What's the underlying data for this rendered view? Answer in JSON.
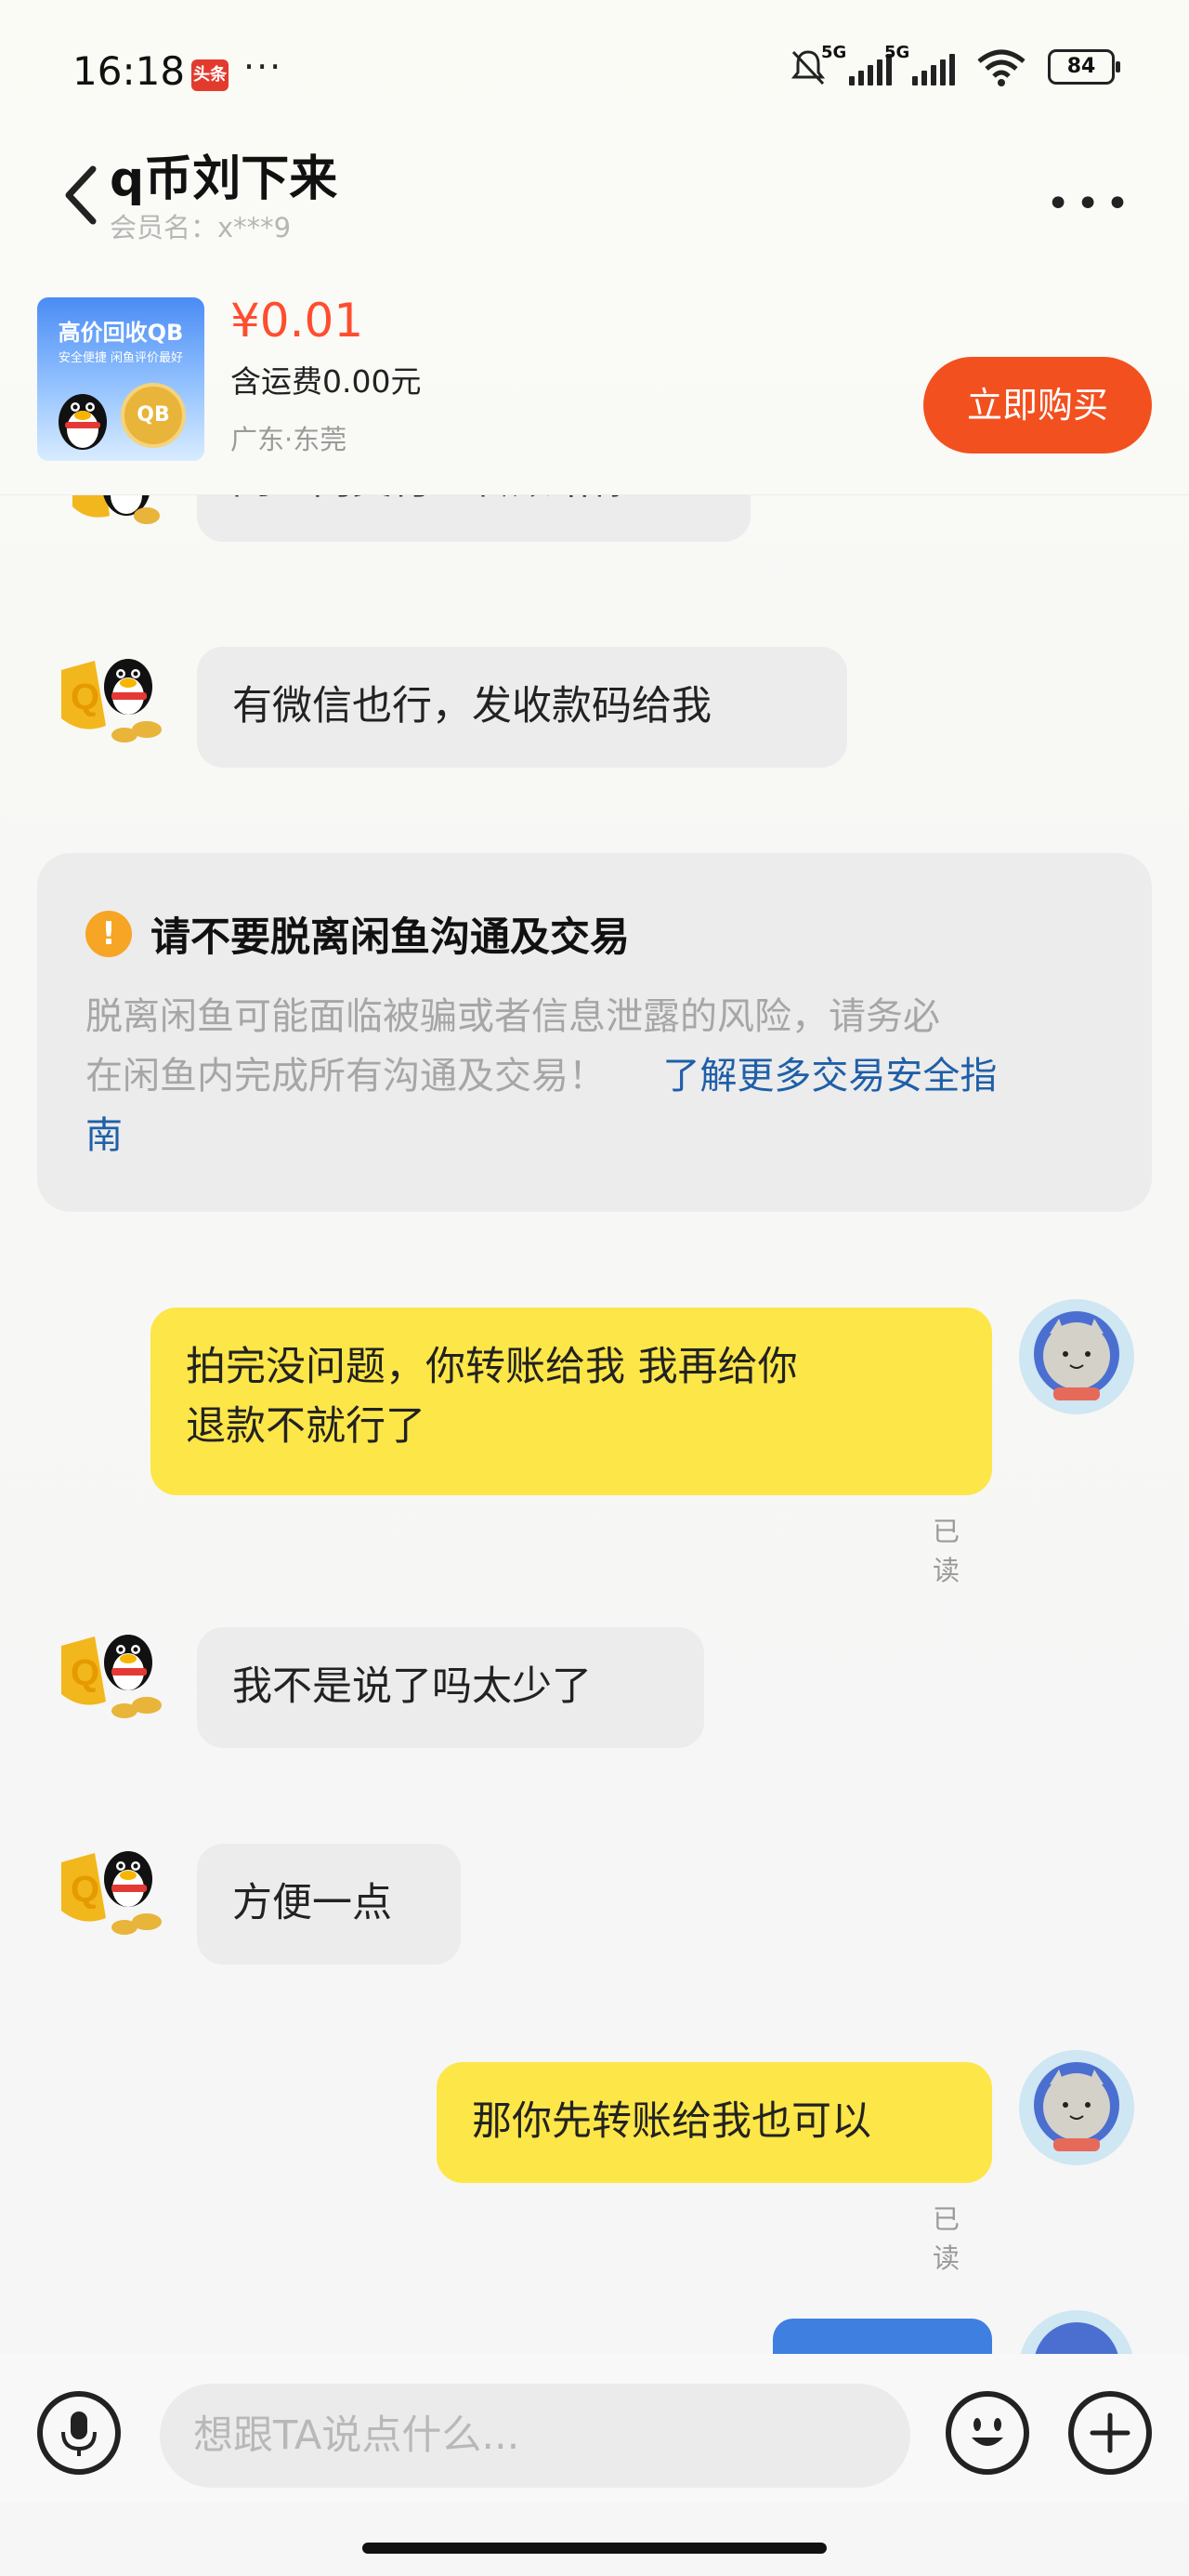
{
  "status": {
    "time": "16:18",
    "toutiao_badge": "头条",
    "battery": "84"
  },
  "header": {
    "title": "q币刘下来",
    "subtitle": "会员名：x***9"
  },
  "product": {
    "thumb_title": "高价回收QB",
    "thumb_sub": "安全便捷    闲鱼评价最好",
    "thumb_coin": "QB",
    "price": "¥0.01",
    "shipping": "含运费0.00元",
    "location": "广东·东莞",
    "buy_label": "立即购买"
  },
  "messages": [
    {
      "side": "left",
      "text": "闲鱼内支付宝转账给你"
    },
    {
      "side": "left",
      "text": "有微信也行，发收款码给我"
    },
    {
      "side": "right",
      "text_line1": "拍完没问题，你转账给我 我再给你",
      "text_line2": "退款不就行了",
      "read": "已读"
    },
    {
      "side": "left",
      "text": "我不是说了吗太少了"
    },
    {
      "side": "left",
      "text": "方便一点"
    },
    {
      "side": "right",
      "text": "那你先转账给我也可以",
      "read": "已读"
    }
  ],
  "warning": {
    "title": "请不要脱离闲鱼沟通及交易",
    "body_line1": "脱离闲鱼可能面临被骗或者信息泄露的风险，请务必",
    "body_line2": "在闲鱼内完成所有沟通及交易！",
    "link_text": "了解更多交易安全指",
    "link_text_2": "南"
  },
  "input": {
    "placeholder": "想跟TA说点什么..."
  },
  "colors": {
    "accent": "#f3501f",
    "price": "#ff4d2f",
    "my_bubble": "#fde648",
    "their_bubble": "#ececec",
    "link": "#1f5fa8"
  }
}
